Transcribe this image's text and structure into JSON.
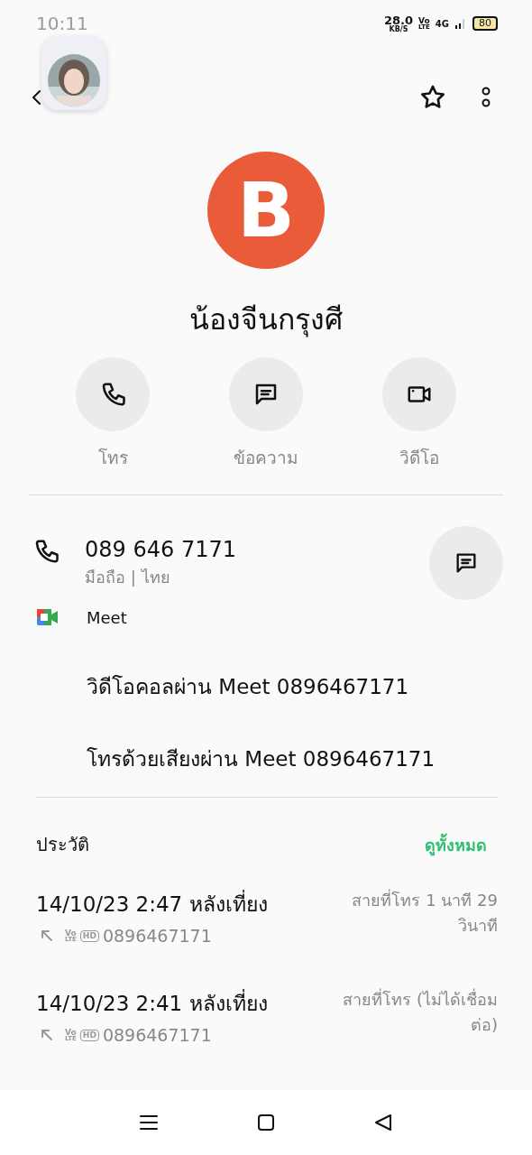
{
  "status_bar": {
    "time": "10:11",
    "speed": "28.0",
    "speed_unit": "KB/S",
    "volte_top": "Vo",
    "volte_bottom": "LTE",
    "network": "4G",
    "battery": "80"
  },
  "header": {
    "starred": false
  },
  "contact": {
    "avatar_letter": "B",
    "name": "น้องจีนกรุงศี"
  },
  "actions": [
    {
      "kind": "call",
      "label": "โทร"
    },
    {
      "kind": "message",
      "label": "ข้อความ"
    },
    {
      "kind": "video",
      "label": "วิดีโอ"
    }
  ],
  "phone": {
    "number": "089 646 7171",
    "type": "มือถือ | ไทย"
  },
  "meet": {
    "label": "Meet",
    "options": [
      "วิดีโอคอลผ่าน Meet 0896467171",
      "โทรด้วยเสียงผ่าน Meet 0896467171"
    ]
  },
  "history": {
    "title": "ประวัติ",
    "see_all": "ดูทั้งหมด",
    "entries": [
      {
        "datetime": "14/10/23 2:47 หลังเที่ยง",
        "volte_top": "Vo",
        "volte_bottom": "LTE",
        "quality": "HD",
        "number": "0896467171",
        "status": "สายที่โทร  1 นาที 29 วินาที"
      },
      {
        "datetime": "14/10/23 2:41 หลังเที่ยง",
        "volte_top": "Vo",
        "volte_bottom": "LTE",
        "quality": "HD",
        "number": "0896467171",
        "status": "สายที่โทร (ไม่ได้เชื่อม ต่อ)"
      }
    ]
  }
}
